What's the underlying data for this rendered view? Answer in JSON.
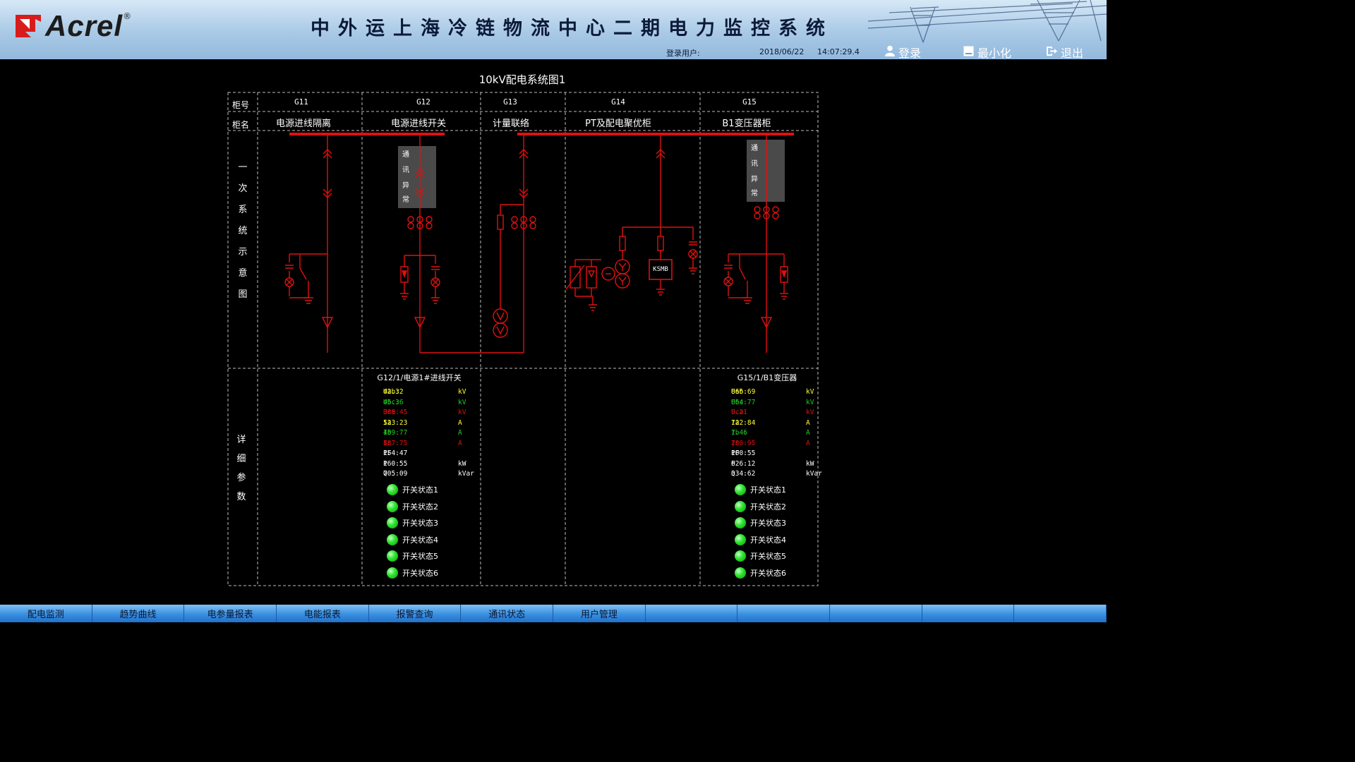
{
  "header": {
    "logo_text": "Acrel",
    "logo_reg": "®",
    "title": "中外运上海冷链物流中心二期电力监控系统",
    "login_user_label": "登录用户:",
    "date": "2018/06/22",
    "time": "14:07:29.4",
    "login_button": "登录",
    "minimize_button": "最小化",
    "exit_button": "退出"
  },
  "diagram": {
    "title": "10kV配电系统图1",
    "row_cabinet_no": "柜号",
    "row_cabinet_name": "柜名",
    "primary_label": [
      "一",
      "次",
      "系",
      "统",
      "示",
      "意",
      "图"
    ],
    "detail_label": [
      "详",
      "细",
      "参",
      "数"
    ],
    "cabinets": [
      {
        "no": "G11",
        "name": "电源进线隔离"
      },
      {
        "no": "G12",
        "name": "电源进线开关"
      },
      {
        "no": "G13",
        "name": "计量联络"
      },
      {
        "no": "G14",
        "name": "PT及配电聚优柜"
      },
      {
        "no": "G15",
        "name": "B1变压器柜"
      }
    ],
    "comm_box_text": [
      "通",
      "讯",
      "异",
      "常"
    ],
    "ksmb": "KSMB"
  },
  "details": {
    "g12": {
      "title": "G12/1/电源1#进线开关",
      "rows": [
        {
          "name": "Uab:",
          "value": "42.32",
          "unit": "kV",
          "color": "#ffff33"
        },
        {
          "name": "Ubc:",
          "value": "45.36",
          "unit": "kV",
          "color": "#22cc22"
        },
        {
          "name": "Uca:",
          "value": "388.45",
          "unit": "kV",
          "color": "#e01010"
        },
        {
          "name": "Ia :",
          "value": "523.23",
          "unit": "A",
          "color": "#ffff33"
        },
        {
          "name": "Ib :",
          "value": "489.77",
          "unit": "A",
          "color": "#22cc22"
        },
        {
          "name": "Ic :",
          "value": "887.75",
          "unit": "A",
          "color": "#e01010"
        },
        {
          "name": "PF :",
          "value": "154.47",
          "unit": "",
          "color": "#ffffff"
        },
        {
          "name": "P  :",
          "value": "160.55",
          "unit": "kW",
          "color": "#ffffff"
        },
        {
          "name": "Q  :",
          "value": "705.09",
          "unit": "kVar",
          "color": "#ffffff"
        }
      ],
      "switches": [
        "开关状态1",
        "开关状态2",
        "开关状态3",
        "开关状态4",
        "开关状态5",
        "开关状态6"
      ]
    },
    "g15": {
      "title": "G15/1/B1变压器",
      "rows": [
        {
          "name": "Uab:",
          "value": "866.69",
          "unit": "kV",
          "color": "#ffff33"
        },
        {
          "name": "Ubc:",
          "value": "664.77",
          "unit": "kV",
          "color": "#22cc22"
        },
        {
          "name": "Uca:",
          "value": "0.21",
          "unit": "kV",
          "color": "#e01010"
        },
        {
          "name": "Ia :",
          "value": "722.84",
          "unit": "A",
          "color": "#ffff33"
        },
        {
          "name": "Ib :",
          "value": "7.46",
          "unit": "A",
          "color": "#22cc22"
        },
        {
          "name": "Ic :",
          "value": "280.95",
          "unit": "A",
          "color": "#e01010"
        },
        {
          "name": "PF :",
          "value": "100.55",
          "unit": "",
          "color": "#ffffff"
        },
        {
          "name": "P  :",
          "value": "626.12",
          "unit": "kW",
          "color": "#ffffff"
        },
        {
          "name": "Q  :",
          "value": "334.62",
          "unit": "kVar",
          "color": "#ffffff"
        }
      ],
      "switches": [
        "开关状态1",
        "开关状态2",
        "开关状态3",
        "开关状态4",
        "开关状态5",
        "开关状态6"
      ]
    }
  },
  "footer": {
    "tabs": [
      "配电监测",
      "趋势曲线",
      "电参量报表",
      "电能报表",
      "报警查询",
      "通讯状态",
      "用户管理",
      "",
      "",
      "",
      "",
      ""
    ]
  },
  "colors": {
    "line_red": "#e01010",
    "grid_dash": "#bbbbbb",
    "header_bg": "#a9c9e6",
    "footer_bg": "#3a8fe0",
    "led_green": "#32e632"
  }
}
